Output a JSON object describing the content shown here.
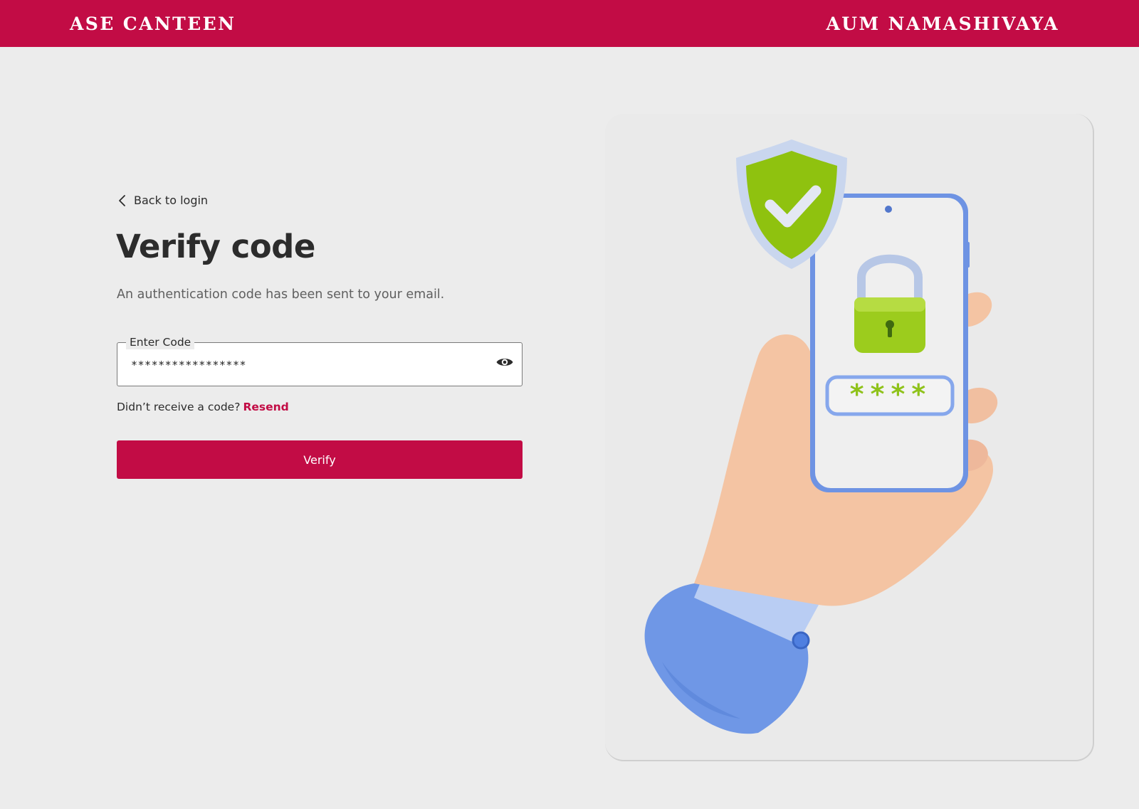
{
  "header": {
    "brand_left": "ASE CANTEEN",
    "brand_right": "AUM NAMASHIVAYA",
    "accent_color": "#c20c45"
  },
  "form": {
    "back_label": "Back to login",
    "title": "Verify code",
    "subtitle": "An authentication code has been sent to your email.",
    "code_field": {
      "label": "Enter Code",
      "value": "*****************",
      "toggle_icon": "eye-icon"
    },
    "resend": {
      "prompt": "Didn’t receive a code?",
      "link": "Resend"
    },
    "submit_label": "Verify"
  },
  "illustration": {
    "icons": [
      "shield-check-icon",
      "padlock-icon",
      "phone-icon",
      "hand-icon"
    ],
    "pin_mask": "****"
  }
}
